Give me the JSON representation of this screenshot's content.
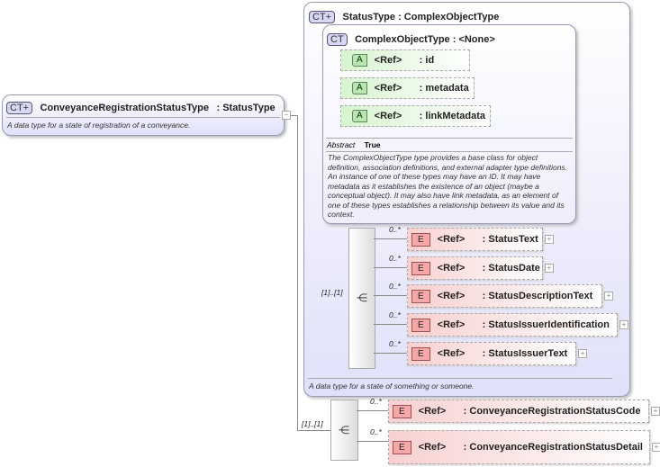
{
  "root": {
    "badge": "CT+",
    "name": "ConveyanceRegistrationStatusType",
    "type": ": StatusType",
    "description": "A data type for a state of registration of a conveyance.",
    "toggle": "−"
  },
  "status_type": {
    "badge": "CT+",
    "title": "StatusType : ComplexObjectType",
    "description": "A data type for a state of something or someone."
  },
  "complex_object_type": {
    "badge": "CT",
    "title": "ComplexObjectType : <None>",
    "abstract_label": "Abstract",
    "abstract_value": "True",
    "description": "The ComplexObjectType type provides a base class for object definition, association definitions, and external adapter type definitions. An instance of one of these types may have an ID. It may have metadata as it establishes the existence of an object (maybe a conceptual object). It may also have link metadata, as an element of one of these types establishes a relationship between its value and its context.",
    "attributes": [
      {
        "badge": "A",
        "ref": "<Ref>",
        "name": ": id"
      },
      {
        "badge": "A",
        "ref": "<Ref>",
        "name": ": metadata"
      },
      {
        "badge": "A",
        "ref": "<Ref>",
        "name": ": linkMetadata"
      }
    ]
  },
  "sequence1": {
    "cardinality": "[1]..[1]",
    "elements": [
      {
        "badge": "E",
        "ref": "<Ref>",
        "name": ": StatusText",
        "card": "0..*"
      },
      {
        "badge": "E",
        "ref": "<Ref>",
        "name": ": StatusDate",
        "card": "0..*"
      },
      {
        "badge": "E",
        "ref": "<Ref>",
        "name": ": StatusDescriptionText",
        "card": "0..*"
      },
      {
        "badge": "E",
        "ref": "<Ref>",
        "name": ": StatusIssuerIdentification",
        "card": "0..*"
      },
      {
        "badge": "E",
        "ref": "<Ref>",
        "name": ": StatusIssuerText",
        "card": "0..*"
      }
    ]
  },
  "sequence2": {
    "cardinality": "[1]..[1]",
    "elements": [
      {
        "badge": "E",
        "ref": "<Ref>",
        "name": ": ConveyanceRegistrationStatusCode",
        "card": "0..*"
      },
      {
        "badge": "E",
        "ref": "<Ref>",
        "name": ": ConveyanceRegistrationStatusDetail",
        "card": "0..*"
      }
    ]
  }
}
